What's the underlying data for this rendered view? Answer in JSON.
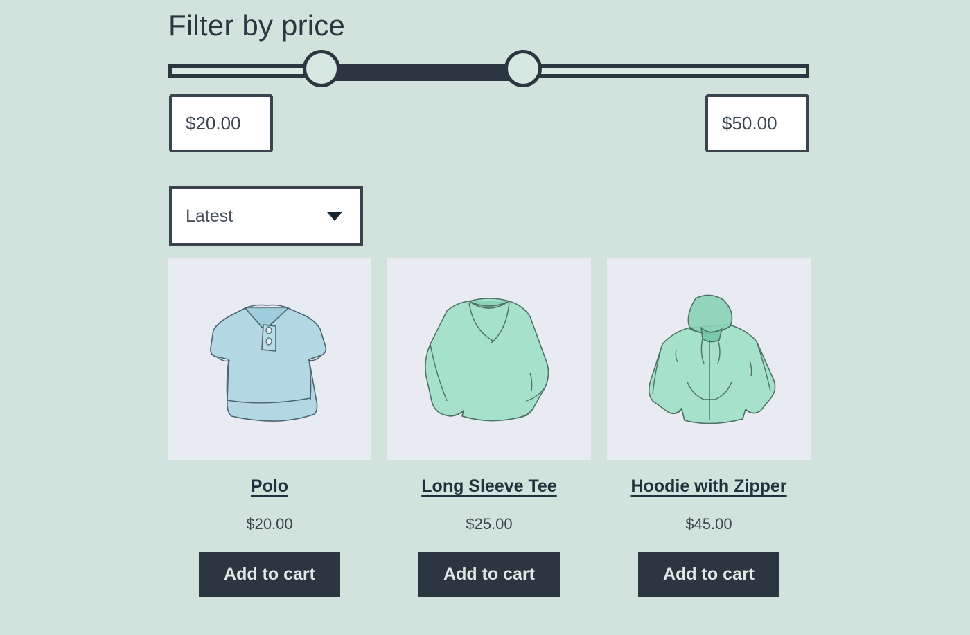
{
  "filter": {
    "title": "Filter by price",
    "min_value": "$20.00",
    "max_value": "$50.00",
    "slider": {
      "min_handle_name": "price-slider-min-handle",
      "max_handle_name": "price-slider-max-handle"
    }
  },
  "sort": {
    "selected": "Latest",
    "caret_icon": "chevron-down-icon"
  },
  "products": [
    {
      "title": "Polo",
      "price": "$20.00",
      "button": "Add to cart",
      "image_icon": "polo-shirt-illustration",
      "image_color": "#a9d4e0"
    },
    {
      "title": "Long Sleeve Tee",
      "price": "$25.00",
      "button": "Add to cart",
      "image_icon": "long-sleeve-tee-illustration",
      "image_color": "#9fe0c6"
    },
    {
      "title": "Hoodie with Zipper",
      "price": "$45.00",
      "button": "Add to cart",
      "image_icon": "hoodie-with-zipper-illustration",
      "image_color": "#9fe0c6"
    }
  ],
  "colors": {
    "page_background": "#d2e3dd",
    "ink": "#2b3640",
    "thumb_background": "#e8ecf2",
    "button_background": "#2b3640",
    "button_text": "#dfeae5"
  }
}
